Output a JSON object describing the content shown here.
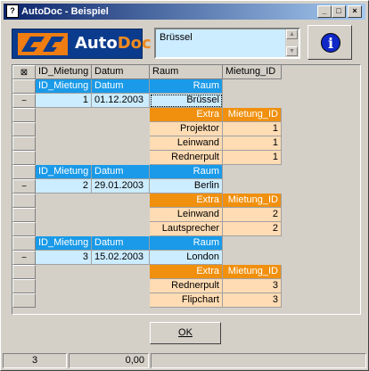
{
  "window": {
    "title": "AutoDoc - Beispiel",
    "icon": "app-icon"
  },
  "logo": {
    "text_auto": "Auto",
    "text_doc": "Doc"
  },
  "memo": {
    "value": "Brüssel"
  },
  "info_button": {
    "icon": "info-icon",
    "glyph": "i"
  },
  "grid": {
    "columns": [
      "ID_Mietung",
      "Datum",
      "Raum",
      "Mietung_ID"
    ],
    "corner_icon": "grid-corner-icon",
    "records": [
      {
        "header": [
          "ID_Mietung",
          "Datum",
          "Raum"
        ],
        "row": [
          "1",
          "01.12.2003",
          "Brüssel"
        ],
        "sub_header": [
          "Extra",
          "Mietung_ID"
        ],
        "sub_rows": [
          [
            "Projektor",
            "1"
          ],
          [
            "Leinwand",
            "1"
          ],
          [
            "Rednerpult",
            "1"
          ]
        ]
      },
      {
        "header": [
          "ID_Mietung",
          "Datum",
          "Raum"
        ],
        "row": [
          "2",
          "29.01.2003",
          "Berlin"
        ],
        "sub_header": [
          "Extra",
          "Mietung_ID"
        ],
        "sub_rows": [
          [
            "Leinwand",
            "2"
          ],
          [
            "Lautsprecher",
            "2"
          ]
        ]
      },
      {
        "header": [
          "ID_Mietung",
          "Datum",
          "Raum"
        ],
        "row": [
          "3",
          "15.02.2003",
          "London"
        ],
        "sub_header": [
          "Extra",
          "Mietung_ID"
        ],
        "sub_rows": [
          [
            "Rednerpult",
            "3"
          ],
          [
            "Flipchart",
            "3"
          ]
        ]
      }
    ],
    "collapse_glyph": "−"
  },
  "ok_button": {
    "label": "OK"
  },
  "statusbar": {
    "count": "3",
    "value": "0,00"
  },
  "colors": {
    "header_blue": "#1a9ae8",
    "row_lightblue": "#ccecff",
    "header_orange": "#f0900e",
    "row_lightorange": "#ffdcb4"
  }
}
